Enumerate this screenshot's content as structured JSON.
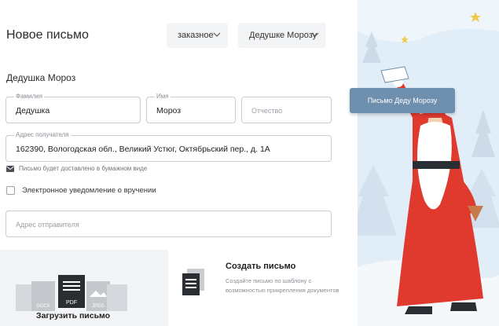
{
  "header": {
    "title": "Новое письмо",
    "letter_type": "заказное",
    "recipient_select": "Дедушке Морозу"
  },
  "recipient": {
    "name": "Дедушка Мороз",
    "last_name": {
      "label": "Фамилия",
      "value": "Дедушка"
    },
    "first_name": {
      "label": "Имя",
      "value": "Мороз"
    },
    "middle_name": {
      "placeholder": "Отчество"
    },
    "address": {
      "label": "Адрес получателя",
      "value": "162390, Вологодская обл., Великий Устюг, Октябрьский пер., д. 1А"
    },
    "delivery_note": "Письмо будет доставлено в бумажном виде"
  },
  "electronic_notice": {
    "label": "Электронное уведомление о вручении",
    "checked": false
  },
  "sender": {
    "address_placeholder": "Адрес отправителя"
  },
  "upload": {
    "label": "Загрузить письмо",
    "formats": [
      "DOCX",
      "PDF",
      "JPEG"
    ]
  },
  "create": {
    "title": "Создать письмо",
    "description": "Создайте письмо по шаблону с возможностью прикрепления документов"
  },
  "illustration": {
    "button_label": "Письмо Деду Морозу",
    "colors": {
      "santa_red": "#e03a2f",
      "sky": "#e2eef7",
      "accent": "#6f8fae"
    }
  }
}
